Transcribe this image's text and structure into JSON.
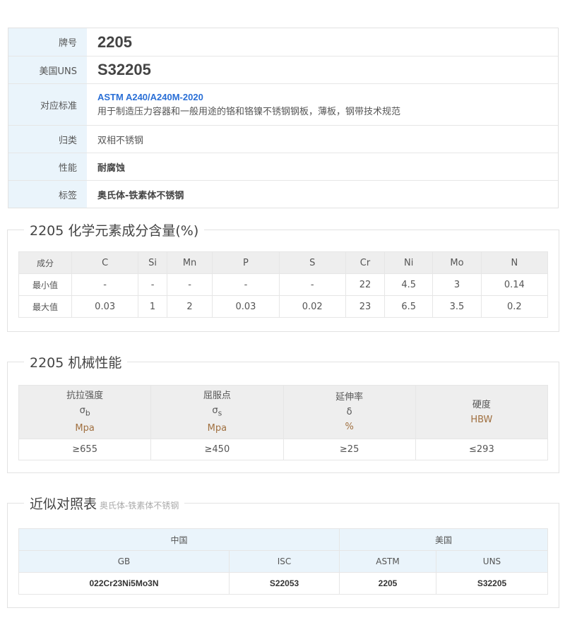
{
  "info": {
    "grade_label": "牌号",
    "grade_value": "2205",
    "uns_label": "美国UNS",
    "uns_value": "S32205",
    "standard_label": "对应标准",
    "standard_code": "ASTM A240/A240M-2020",
    "standard_desc": "用于制造压力容器和一般用途的铬和铬镍不锈钢钢板，薄板，钢带技术规范",
    "category_label": "归类",
    "category_value": "双相不锈钢",
    "property_label": "性能",
    "property_value": "耐腐蚀",
    "tag_label": "标签",
    "tag_value": "奥氏体-铁素体不锈钢"
  },
  "chemical": {
    "title": "2205 化学元素成分含量(%)",
    "header_label": "成分",
    "elements": [
      "C",
      "Si",
      "Mn",
      "P",
      "S",
      "Cr",
      "Ni",
      "Mo",
      "N"
    ],
    "min_label": "最小值",
    "min": [
      "-",
      "-",
      "-",
      "-",
      "-",
      "22",
      "4.5",
      "3",
      "0.14"
    ],
    "max_label": "最大值",
    "max": [
      "0.03",
      "1",
      "2",
      "0.03",
      "0.02",
      "23",
      "6.5",
      "3.5",
      "0.2"
    ]
  },
  "mechanical": {
    "title": "2205 机械性能",
    "props": [
      {
        "name": "抗拉强度",
        "symbol": "σ",
        "sub": "b",
        "unit": "Mpa",
        "value": "≥655"
      },
      {
        "name": "屈服点",
        "symbol": "σ",
        "sub": "s",
        "unit": "Mpa",
        "value": "≥450"
      },
      {
        "name": "延伸率",
        "symbol": "δ",
        "sub": "",
        "unit": "%",
        "value": "≥25"
      },
      {
        "name": "硬度",
        "symbol": "",
        "sub": "",
        "unit": "HBW",
        "value": "≤293"
      }
    ]
  },
  "comparison": {
    "title": "近似对照表",
    "subtitle": "奥氏体-铁素体不锈钢",
    "china_label": "中国",
    "usa_label": "美国",
    "cols": [
      "GB",
      "ISC",
      "ASTM",
      "UNS"
    ],
    "vals": [
      "022Cr23Ni5Mo3N",
      "S22053",
      "2205",
      "S32205"
    ]
  }
}
